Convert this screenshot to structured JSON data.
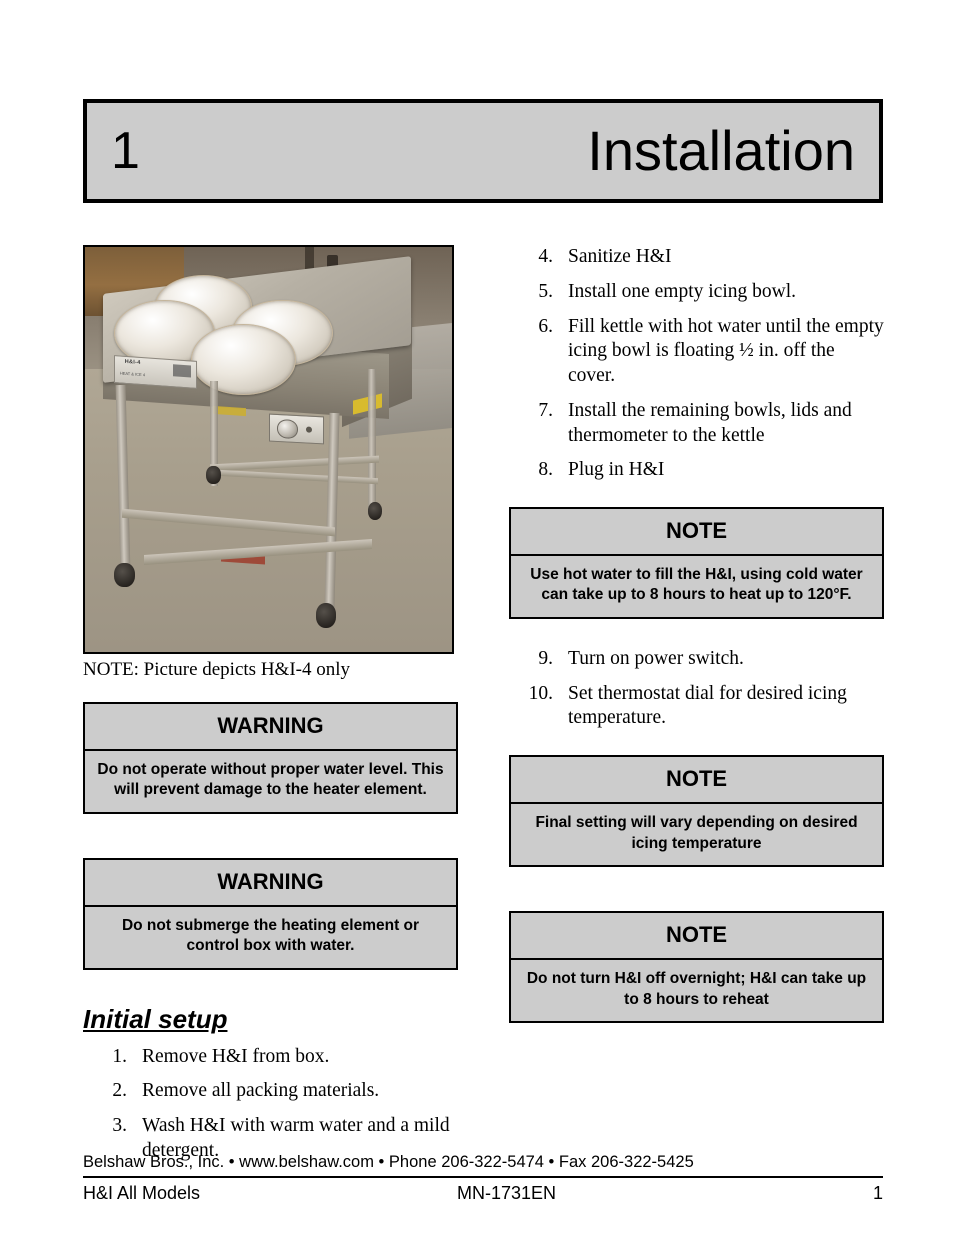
{
  "header": {
    "chapter_number": "1",
    "chapter_title": "Installation"
  },
  "photo": {
    "alt_name": "h-and-i-4-icing-kettle-cart-photo",
    "nameplate_line1": "H&I-4",
    "nameplate_line2": "HEAT & ICE 4",
    "caption": "NOTE:  Picture depicts H&I-4 only"
  },
  "left_column": {
    "warnings": [
      {
        "title": "WARNING",
        "body": "Do not operate without proper water level. This will prevent damage to the heater element."
      },
      {
        "title": "WARNING",
        "body": "Do not submerge the heating element or control box with water."
      }
    ],
    "section": {
      "heading": "Initial setup",
      "steps": [
        {
          "num": "1.",
          "text": "Remove H&I from box."
        },
        {
          "num": "2.",
          "text": "Remove all packing materials."
        },
        {
          "num": "3.",
          "text": "Wash H&I with warm water and a mild detergent."
        }
      ]
    }
  },
  "right_column": {
    "steps_group_1": [
      {
        "num": "4.",
        "text": "Sanitize H&I"
      },
      {
        "num": "5.",
        "text": "Install one empty icing bowl."
      },
      {
        "num": "6.",
        "text": "Fill kettle with hot water until the empty icing bowl is floating ½ in. off the cover."
      },
      {
        "num": "7.",
        "text": "Install the remaining bowls, lids and thermometer to the kettle"
      },
      {
        "num": "8.",
        "text": "Plug in H&I"
      }
    ],
    "note_1": {
      "title": "NOTE",
      "body": "Use hot water to fill the H&I, using cold water can take up to 8 hours to heat up to 120°F."
    },
    "steps_group_2": [
      {
        "num": "9.",
        "text": "Turn on power switch."
      },
      {
        "num": "10.",
        "text": "Set thermostat dial for desired icing temperature."
      }
    ],
    "note_2": {
      "title": "NOTE",
      "body": "Final setting will vary depending on desired icing temperature"
    },
    "note_3": {
      "title": "NOTE",
      "body": "Do not turn H&I off overnight; H&I can take up to 8 hours to reheat"
    }
  },
  "footer": {
    "company_line": "Belshaw Bros., Inc. • www.belshaw.com • Phone 206-322-5474 • Fax 206-322-5425",
    "model": "H&I All Models",
    "doc_number": "MN-1731EN",
    "page_number": "1"
  },
  "colors": {
    "box_fill": "#cccccc",
    "box_border": "#000000",
    "text": "#000000",
    "page_background": "#ffffff"
  }
}
